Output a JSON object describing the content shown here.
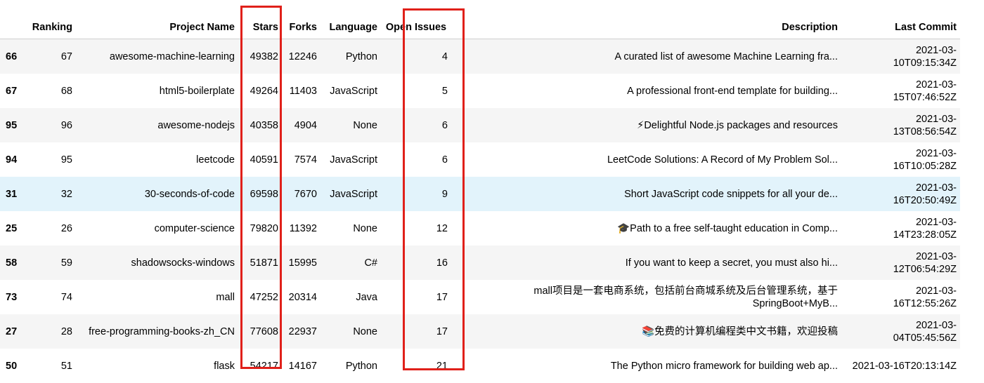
{
  "table": {
    "columns": {
      "index": "",
      "ranking": "Ranking",
      "project_name": "Project Name",
      "stars": "Stars",
      "forks": "Forks",
      "language": "Language",
      "open_issues": "Open Issues",
      "description": "Description",
      "last_commit": "Last Commit"
    },
    "rows": [
      {
        "index": "66",
        "ranking": "67",
        "project_name": "awesome-machine-learning",
        "stars": "49382",
        "forks": "12246",
        "language": "Python",
        "open_issues": "4",
        "description": "A curated list of awesome Machine Learning fra...",
        "last_commit": "2021-03-10T09:15:34Z"
      },
      {
        "index": "67",
        "ranking": "68",
        "project_name": "html5-boilerplate",
        "stars": "49264",
        "forks": "11403",
        "language": "JavaScript",
        "open_issues": "5",
        "description": "A professional front-end template for building...",
        "last_commit": "2021-03-15T07:46:52Z"
      },
      {
        "index": "95",
        "ranking": "96",
        "project_name": "awesome-nodejs",
        "stars": "40358",
        "forks": "4904",
        "language": "None",
        "open_issues": "6",
        "description": "⚡Delightful Node.js packages and resources",
        "last_commit": "2021-03-13T08:56:54Z"
      },
      {
        "index": "94",
        "ranking": "95",
        "project_name": "leetcode",
        "stars": "40591",
        "forks": "7574",
        "language": "JavaScript",
        "open_issues": "6",
        "description": "LeetCode Solutions: A Record of My Problem Sol...",
        "last_commit": "2021-03-16T10:05:28Z"
      },
      {
        "index": "31",
        "ranking": "32",
        "project_name": "30-seconds-of-code",
        "stars": "69598",
        "forks": "7670",
        "language": "JavaScript",
        "open_issues": "9",
        "description": "Short JavaScript code snippets for all your de...",
        "last_commit": "2021-03-16T20:50:49Z"
      },
      {
        "index": "25",
        "ranking": "26",
        "project_name": "computer-science",
        "stars": "79820",
        "forks": "11392",
        "language": "None",
        "open_issues": "12",
        "description": "🎓Path to a free self-taught education in Comp...",
        "last_commit": "2021-03-14T23:28:05Z"
      },
      {
        "index": "58",
        "ranking": "59",
        "project_name": "shadowsocks-windows",
        "stars": "51871",
        "forks": "15995",
        "language": "C#",
        "open_issues": "16",
        "description": "If you want to keep a secret, you must also hi...",
        "last_commit": "2021-03-12T06:54:29Z"
      },
      {
        "index": "73",
        "ranking": "74",
        "project_name": "mall",
        "stars": "47252",
        "forks": "20314",
        "language": "Java",
        "open_issues": "17",
        "description": "mall项目是一套电商系统，包括前台商城系统及后台管理系统，基于SpringBoot+MyB...",
        "last_commit": "2021-03-16T12:55:26Z"
      },
      {
        "index": "27",
        "ranking": "28",
        "project_name": "free-programming-books-zh_CN",
        "stars": "77608",
        "forks": "22937",
        "language": "None",
        "open_issues": "17",
        "description": "📚免费的计算机编程类中文书籍，欢迎投稿",
        "last_commit": "2021-03-04T05:45:56Z"
      },
      {
        "index": "50",
        "ranking": "51",
        "project_name": "flask",
        "stars": "54217",
        "forks": "14167",
        "language": "Python",
        "open_issues": "21",
        "description": "The Python micro framework for building web ap...",
        "last_commit": "2021-03-16T20:13:14Z"
      }
    ]
  },
  "highlights": {
    "color": "#e0201a",
    "columns": [
      "Stars",
      "Open Issues"
    ]
  },
  "hovered_row_index": "31"
}
